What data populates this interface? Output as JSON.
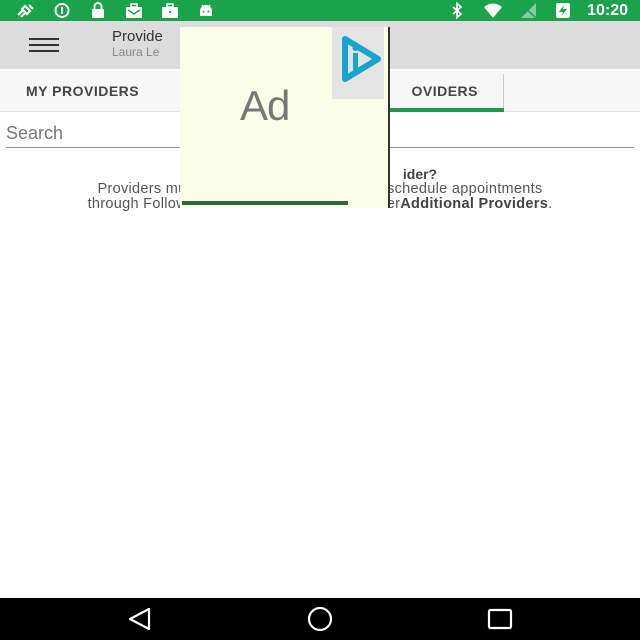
{
  "status_bar": {
    "time": "10:20",
    "bg_color": "#1aa34a",
    "left_icons": [
      "satellite-icon",
      "info-icon",
      "lock-icon",
      "briefcase-mail-icon",
      "briefcase-icon",
      "android-icon"
    ],
    "right_icons": [
      "bluetooth-icon",
      "wifi-icon",
      "signal-off-icon",
      "battery-charging-icon"
    ]
  },
  "toolbar": {
    "title": "Provide",
    "subtitle": "Laura Le"
  },
  "tabs": [
    {
      "label": "MY PROVIDERS",
      "active": false
    },
    {
      "label": "OVIDERS",
      "active": true
    }
  ],
  "search": {
    "placeholder": "Search",
    "value": ""
  },
  "message": {
    "question_fragment": "ider?",
    "line1_start": "Providers must a",
    "line1_end": "schedule appointments",
    "line2_start": "through FollowM",
    "line2_middle": "ler",
    "line2_bold": "Additional Providers",
    "line2_end": "."
  },
  "ad": {
    "label": "Ad",
    "bg_color": "#fafde7"
  },
  "nav_bar": {
    "buttons": [
      "back-icon",
      "home-icon",
      "recent-apps-icon"
    ]
  }
}
